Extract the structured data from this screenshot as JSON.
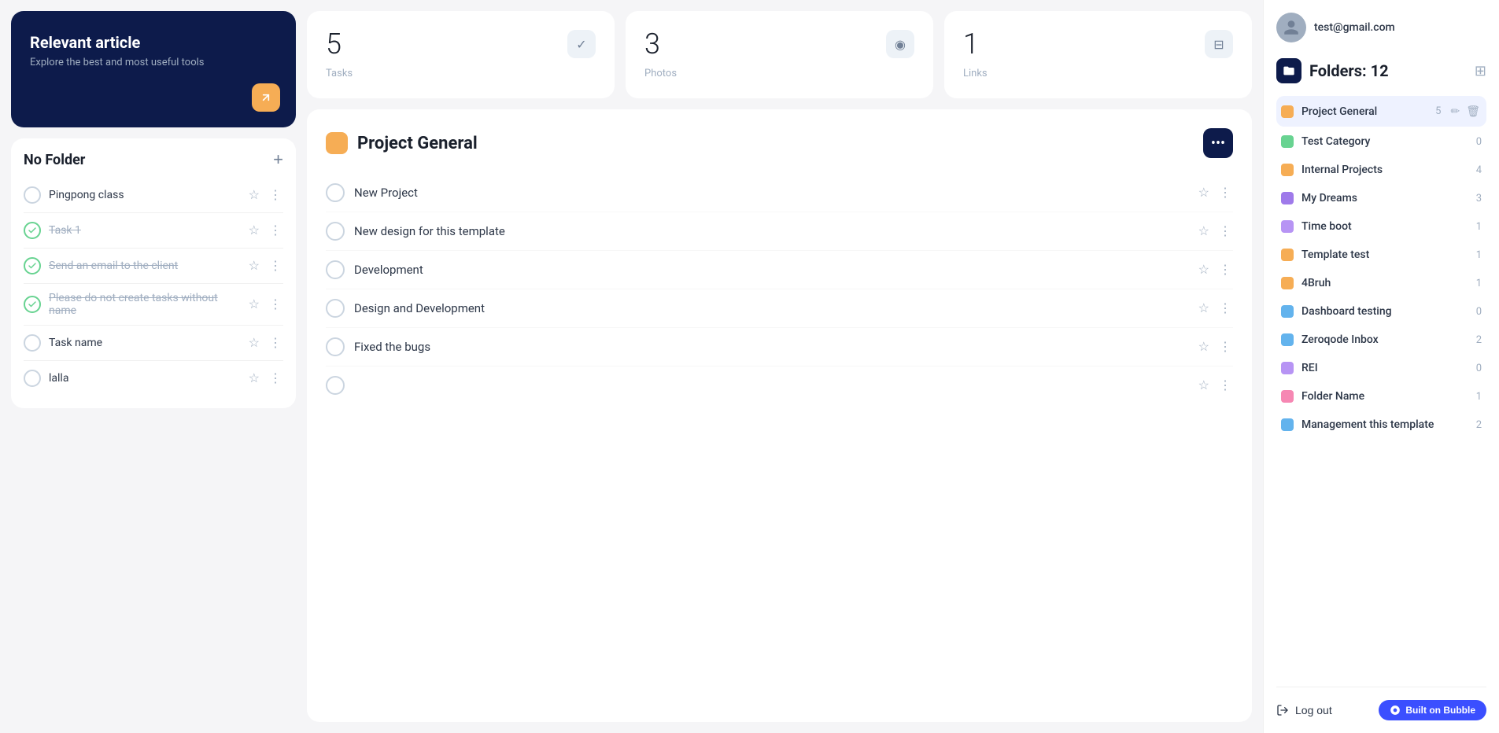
{
  "promo": {
    "title": "Relevant article",
    "subtitle": "Explore the best and most useful tools",
    "arrow_label": "↗"
  },
  "no_folder": {
    "title": "No Folder",
    "add_label": "+",
    "tasks": [
      {
        "id": 1,
        "label": "Pingpong class",
        "done": false,
        "strikethrough": false
      },
      {
        "id": 2,
        "label": "Task 1",
        "done": true,
        "strikethrough": true
      },
      {
        "id": 3,
        "label": "Send an email to the client",
        "done": true,
        "strikethrough": true
      },
      {
        "id": 4,
        "label": "Please do not create tasks without name",
        "done": true,
        "strikethrough": true
      },
      {
        "id": 5,
        "label": "Task name",
        "done": false,
        "strikethrough": false
      },
      {
        "id": 6,
        "label": "lalla",
        "done": false,
        "strikethrough": false
      }
    ]
  },
  "stats": [
    {
      "number": "5",
      "label": "Tasks",
      "icon": "✓"
    },
    {
      "number": "3",
      "label": "Photos",
      "icon": "📷"
    },
    {
      "number": "1",
      "label": "Links",
      "icon": "🔖"
    }
  ],
  "project": {
    "name": "Project General",
    "dot_color": "#f6ad55",
    "more_label": "•••",
    "tasks": [
      {
        "label": "New Project",
        "done": false
      },
      {
        "label": "New design for this template",
        "done": false
      },
      {
        "label": "Development",
        "done": false
      },
      {
        "label": "Design and Development",
        "done": false
      },
      {
        "label": "Fixed the bugs",
        "done": false
      },
      {
        "label": "",
        "done": false
      }
    ]
  },
  "sidebar": {
    "user_email": "test@gmail.com",
    "folders_title": "Folders: 12",
    "folders": [
      {
        "name": "Project General",
        "color": "#f6ad55",
        "count": "5",
        "active": true,
        "editable": true
      },
      {
        "name": "Test Category",
        "color": "#68d391",
        "count": "0",
        "active": false,
        "editable": false
      },
      {
        "name": "Internal Projects",
        "color": "#f6ad55",
        "count": "4",
        "active": false,
        "editable": false
      },
      {
        "name": "My Dreams",
        "color": "#9f7aea",
        "count": "3",
        "active": false,
        "editable": false
      },
      {
        "name": "Time boot",
        "color": "#b794f4",
        "count": "1",
        "active": false,
        "editable": false
      },
      {
        "name": "Template test",
        "color": "#f6ad55",
        "count": "1",
        "active": false,
        "editable": false
      },
      {
        "name": "4Bruh",
        "color": "#f6ad55",
        "count": "1",
        "active": false,
        "editable": false
      },
      {
        "name": "Dashboard testing",
        "color": "#63b3ed",
        "count": "0",
        "active": false,
        "editable": false
      },
      {
        "name": "Zeroqode Inbox",
        "color": "#63b3ed",
        "count": "2",
        "active": false,
        "editable": false
      },
      {
        "name": "REI",
        "color": "#b794f4",
        "count": "0",
        "active": false,
        "editable": false
      },
      {
        "name": "Folder Name",
        "color": "#f687b3",
        "count": "1",
        "active": false,
        "editable": false
      },
      {
        "name": "Management this template",
        "color": "#63b3ed",
        "count": "2",
        "active": false,
        "editable": false
      }
    ],
    "logout_label": "Log out",
    "built_on_bubble": "Built on Bubble"
  }
}
